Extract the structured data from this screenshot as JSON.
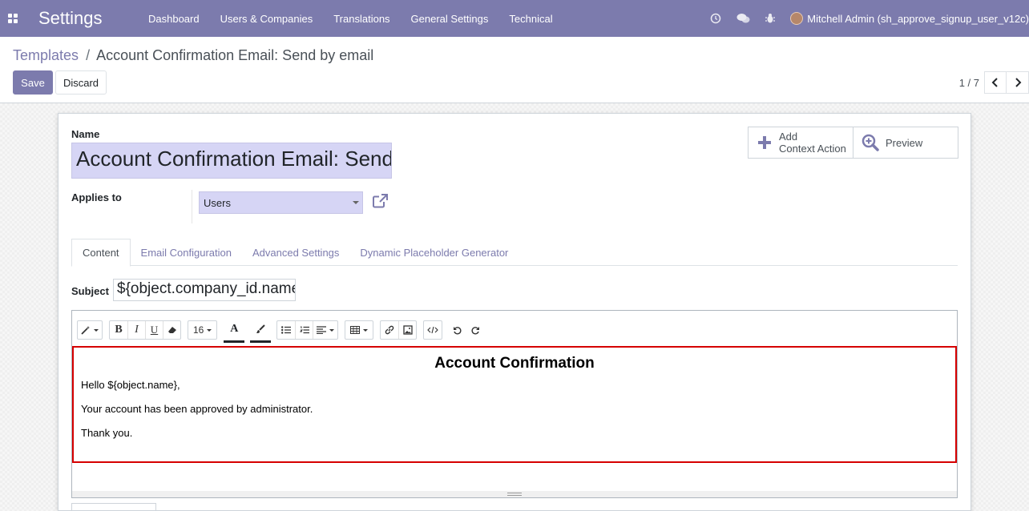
{
  "navbar": {
    "brand": "Settings",
    "menu": [
      "Dashboard",
      "Users & Companies",
      "Translations",
      "General Settings",
      "Technical"
    ],
    "user": "Mitchell Admin (sh_approve_signup_user_v12c)",
    "bg_color": "#7c7bad"
  },
  "breadcrumb": {
    "parent": "Templates",
    "separator": "/",
    "current": "Account Confirmation Email: Send by email"
  },
  "buttons": {
    "save": "Save",
    "discard": "Discard"
  },
  "pager": {
    "value": "1 / 7"
  },
  "form": {
    "name_label": "Name",
    "name_value": "Account Confirmation Email: Send by email",
    "applies_label": "Applies to",
    "applies_value": "Users",
    "add_context_action_line1": "Add",
    "add_context_action_line2": "Context Action",
    "preview": "Preview"
  },
  "tabs": [
    "Content",
    "Email Configuration",
    "Advanced Settings",
    "Dynamic Placeholder Generator"
  ],
  "subject": {
    "label": "Subject",
    "value": "${object.company_id.name}"
  },
  "editor": {
    "font_size": "16",
    "title": "Account Confirmation",
    "lines": [
      "Hello ${object.name},",
      "Your account has been approved by administrator.",
      "Thank you."
    ]
  }
}
